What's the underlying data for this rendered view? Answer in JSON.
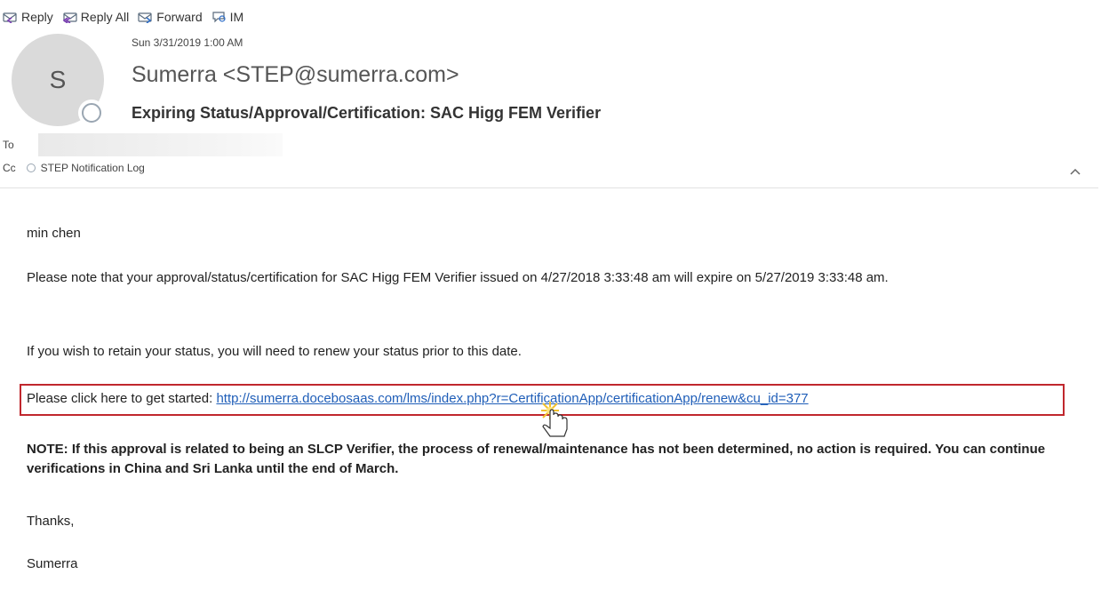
{
  "toolbar": {
    "reply": "Reply",
    "reply_all": "Reply All",
    "forward": "Forward",
    "im": "IM"
  },
  "header": {
    "avatar_initial": "S",
    "date": "Sun 3/31/2019 1:00 AM",
    "sender": "Sumerra <STEP@sumerra.com>",
    "subject": "Expiring Status/Approval/Certification: SAC Higg FEM Verifier",
    "to_label": "To",
    "cc_label": "Cc",
    "cc_value": "STEP Notification Log"
  },
  "body": {
    "greeting": "min chen",
    "para1": "Please note that your approval/status/certification for SAC Higg FEM Verifier issued on 4/27/2018 3:33:48 am will expire on 5/27/2019 3:33:48 am.",
    "para2": "If you wish to retain your status, you will need to renew your status prior to this date.",
    "link_prefix": "Please click here to get started: ",
    "link_url": "http://sumerra.docebosaas.com/lms/index.php?r=CertificationApp/certificationApp/renew&cu_id=377",
    "note": "NOTE: If this approval is related to being an SLCP Verifier, the process of renewal/maintenance has not been determined, no action is required. You can continue verifications in China and Sri Lanka until the end of March.",
    "thanks": "Thanks,",
    "signature": "Sumerra"
  },
  "colors": {
    "link": "#1f5eb8",
    "highlight_box": "#c0272d"
  }
}
